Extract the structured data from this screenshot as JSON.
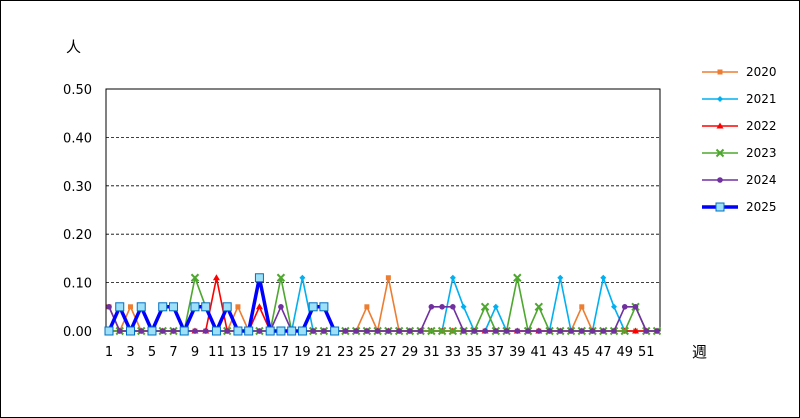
{
  "chart_data": {
    "type": "line",
    "title": "",
    "ylabel": "人",
    "xlabel": "週",
    "ylim": [
      0,
      0.5
    ],
    "yticks": [
      "0.00",
      "0.10",
      "0.20",
      "0.30",
      "0.40",
      "0.50"
    ],
    "x": [
      1,
      2,
      3,
      4,
      5,
      6,
      7,
      8,
      9,
      10,
      11,
      12,
      13,
      14,
      15,
      16,
      17,
      18,
      19,
      20,
      21,
      22,
      23,
      24,
      25,
      26,
      27,
      28,
      29,
      30,
      31,
      32,
      33,
      34,
      35,
      36,
      37,
      38,
      39,
      40,
      41,
      42,
      43,
      44,
      45,
      46,
      47,
      48,
      49,
      50,
      51,
      52
    ],
    "xticks": [
      "1",
      "3",
      "5",
      "7",
      "9",
      "11",
      "13",
      "15",
      "17",
      "19",
      "21",
      "23",
      "25",
      "27",
      "29",
      "31",
      "33",
      "35",
      "37",
      "39",
      "41",
      "43",
      "45",
      "47",
      "49",
      "51"
    ],
    "grid": true,
    "legend_position": "right",
    "series": [
      {
        "name": "2020",
        "color": "#ED7D31",
        "marker": "square",
        "values": [
          0.05,
          0,
          0.05,
          0,
          0,
          0,
          0,
          0,
          0,
          0,
          0,
          0,
          0.05,
          0,
          0,
          0,
          0,
          0,
          0,
          0,
          0,
          0,
          0,
          0,
          0.05,
          0,
          0.11,
          0,
          0,
          0,
          0,
          0,
          0,
          0,
          0,
          0,
          0,
          0,
          0,
          0,
          0,
          0,
          0,
          0,
          0.05,
          0,
          0,
          0,
          0,
          0,
          0,
          0
        ]
      },
      {
        "name": "2021",
        "color": "#00B0F0",
        "marker": "diamond",
        "values": [
          0,
          0,
          0,
          0,
          0,
          0,
          0,
          0,
          0,
          0,
          0,
          0,
          0,
          0,
          0,
          0,
          0,
          0,
          0.11,
          0,
          0,
          0,
          0,
          0,
          0,
          0,
          0,
          0,
          0,
          0,
          0,
          0,
          0.11,
          0.05,
          0,
          0,
          0.05,
          0,
          0,
          0,
          0,
          0,
          0.11,
          0,
          0,
          0,
          0.11,
          0.05,
          0,
          0,
          0,
          0
        ]
      },
      {
        "name": "2022",
        "color": "#FF0000",
        "marker": "triangle",
        "values": [
          0,
          0,
          0,
          0,
          0,
          0,
          0,
          0,
          0,
          0,
          0.11,
          0,
          0,
          0,
          0.05,
          0,
          0,
          0,
          0,
          0,
          0,
          0,
          0,
          0,
          0,
          0,
          0,
          0,
          0,
          0,
          0,
          0,
          0,
          0,
          0,
          0,
          0,
          0,
          0,
          0,
          0,
          0,
          0,
          0,
          0,
          0,
          0,
          0,
          0,
          0,
          0,
          0
        ]
      },
      {
        "name": "2023",
        "color": "#4EA72E",
        "marker": "x",
        "values": [
          0,
          0,
          0,
          0,
          0,
          0,
          0,
          0,
          0.11,
          0.05,
          0,
          0,
          0,
          0,
          0,
          0,
          0.11,
          0,
          0,
          0,
          0,
          0,
          0,
          0,
          0,
          0,
          0,
          0,
          0,
          0,
          0,
          0,
          0,
          0,
          0,
          0.05,
          0,
          0,
          0.11,
          0,
          0.05,
          0,
          0,
          0,
          0,
          0,
          0,
          0,
          0,
          0.05,
          0,
          0
        ]
      },
      {
        "name": "2024",
        "color": "#7030A0",
        "marker": "circle",
        "values": [
          0.05,
          0,
          0,
          0,
          0,
          0,
          0,
          0,
          0,
          0,
          0,
          0,
          0,
          0,
          0,
          0,
          0.05,
          0,
          0,
          0,
          0,
          0,
          0,
          0,
          0,
          0,
          0,
          0,
          0,
          0,
          0.05,
          0.05,
          0.05,
          0,
          0,
          0,
          0,
          0,
          0,
          0,
          0,
          0,
          0,
          0,
          0,
          0,
          0,
          0,
          0.05,
          0.05,
          0,
          0
        ]
      },
      {
        "name": "2025",
        "color": "#0000FF",
        "marker": "square-open",
        "thick": true,
        "values": [
          0,
          0.05,
          0,
          0.05,
          0,
          0.05,
          0.05,
          0,
          0.05,
          0.05,
          0,
          0.05,
          0,
          0,
          0.11,
          0,
          0,
          0,
          0,
          0.05,
          0.05,
          0
        ]
      }
    ]
  }
}
